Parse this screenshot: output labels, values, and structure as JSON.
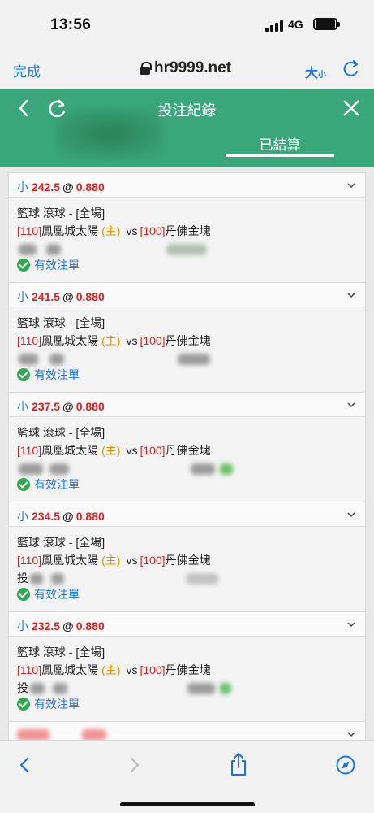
{
  "status": {
    "time": "13:56",
    "network": "4G"
  },
  "browser": {
    "done_label": "完成",
    "url": "hr9999.net",
    "text_size_big": "大",
    "text_size_small": "小"
  },
  "header": {
    "title": "投注紀錄",
    "tab_settled": "已結算"
  },
  "bets": [
    {
      "side": "小",
      "line": "242.5",
      "at": "@",
      "odds": "0.880",
      "sport": "籃球 滾球 - [全場]",
      "home_code": "[110]",
      "home_team": "鳳凰城太陽",
      "home_tag": "(主)",
      "vs": "vs",
      "away_code": "[100]",
      "away_team": "丹佛金塊",
      "detail_prefix": "",
      "status": "有效注單"
    },
    {
      "side": "小",
      "line": "241.5",
      "at": "@",
      "odds": "0.880",
      "sport": "籃球 滾球 - [全場]",
      "home_code": "[110]",
      "home_team": "鳳凰城太陽",
      "home_tag": "(主)",
      "vs": "vs",
      "away_code": "[100]",
      "away_team": "丹佛金塊",
      "detail_prefix": "",
      "status": "有效注單"
    },
    {
      "side": "小",
      "line": "237.5",
      "at": "@",
      "odds": "0.880",
      "sport": "籃球 滾球 - [全場]",
      "home_code": "[110]",
      "home_team": "鳳凰城太陽",
      "home_tag": "(主)",
      "vs": "vs",
      "away_code": "[100]",
      "away_team": "丹佛金塊",
      "detail_prefix": "",
      "status": "有效注單"
    },
    {
      "side": "小",
      "line": "234.5",
      "at": "@",
      "odds": "0.880",
      "sport": "籃球 滾球 - [全場]",
      "home_code": "[110]",
      "home_team": "鳳凰城太陽",
      "home_tag": "(主)",
      "vs": "vs",
      "away_code": "[100]",
      "away_team": "丹佛金塊",
      "detail_prefix": "投",
      "status": "有效注單"
    },
    {
      "side": "小",
      "line": "232.5",
      "at": "@",
      "odds": "0.880",
      "sport": "籃球 滾球 - [全場]",
      "home_code": "[110]",
      "home_team": "鳳凰城太陽",
      "home_tag": "(主)",
      "vs": "vs",
      "away_code": "[100]",
      "away_team": "丹佛金塊",
      "detail_prefix": "投",
      "status": "有效注單"
    }
  ],
  "colors": {
    "header_green": "#3aa77a",
    "link_blue": "#1a73e8",
    "value_red": "#e02020",
    "home_orange": "#e69000",
    "check_green": "#33a852"
  }
}
